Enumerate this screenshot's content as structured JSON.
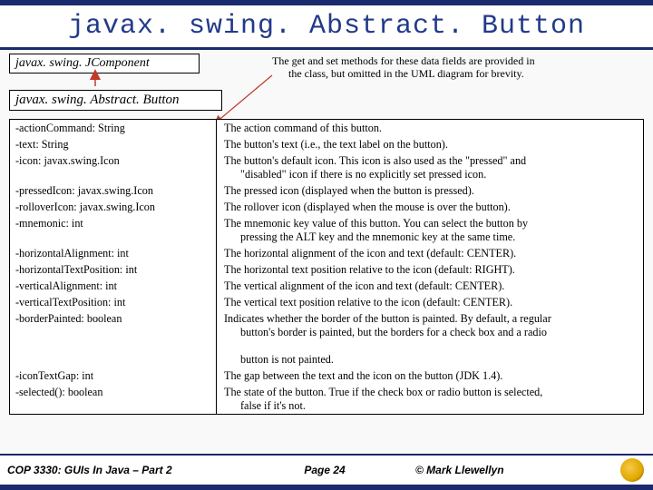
{
  "title": "javax. swing. Abstract. Button",
  "uml": {
    "parent": "javax. swing. JComponent",
    "child": "javax. swing. Abstract. Button"
  },
  "note": {
    "line1": "The get and set methods for these data fields are provided in",
    "line2": "the class, but omitted in the UML diagram for brevity."
  },
  "rows": [
    {
      "l": "-actionCommand: String",
      "r": "The action command of this button."
    },
    {
      "l": "-text: String",
      "r": "The button's text (i.e., the text label on the button)."
    },
    {
      "l": "-icon: javax.swing.Icon",
      "r": "The button's default icon. This icon is also used as the \"pressed\" and",
      "r2": "\"disabled\" icon if there is no explicitly set pressed icon."
    },
    {
      "l": "-pressedIcon: javax.swing.Icon",
      "r": "The pressed icon (displayed when the button is pressed)."
    },
    {
      "l": "-rolloverIcon: javax.swing.Icon",
      "r": "The rollover icon (displayed when the mouse is over the button)."
    },
    {
      "l": "-mnemonic: int",
      "r": "The mnemonic key value of this button. You can select the button by",
      "r2": "pressing the ALT key and the mnemonic key at the same time."
    },
    {
      "l": "-horizontalAlignment: int",
      "r": "The horizontal alignment of the icon and text (default: CENTER)."
    },
    {
      "l": "-horizontalTextPosition: int",
      "r": "The horizontal text position relative to the icon (default: RIGHT)."
    },
    {
      "l": "-verticalAlignment: int",
      "r": "The vertical alignment of the icon and text (default: CENTER)."
    },
    {
      "l": "-verticalTextPosition: int",
      "r": "The vertical text position relative to the icon (default: CENTER)."
    },
    {
      "l": "-borderPainted: boolean",
      "r": "Indicates whether the border of the button is painted. By default, a regular",
      "r2": "button's border is painted, but the borders for a check box and a radio",
      "r3": "button is not painted."
    },
    {
      "l": "-iconTextGap: int",
      "r": "The gap between the text and the icon on the button (JDK 1.4)."
    },
    {
      "l": "-selected(): boolean",
      "r": "The state of the button. True if the check box or radio button is selected,",
      "r2": "false if it's not."
    }
  ],
  "footer": {
    "course": "COP 3330:  GUIs In Java – Part 2",
    "page": "Page 24",
    "copy": "© Mark Llewellyn"
  }
}
